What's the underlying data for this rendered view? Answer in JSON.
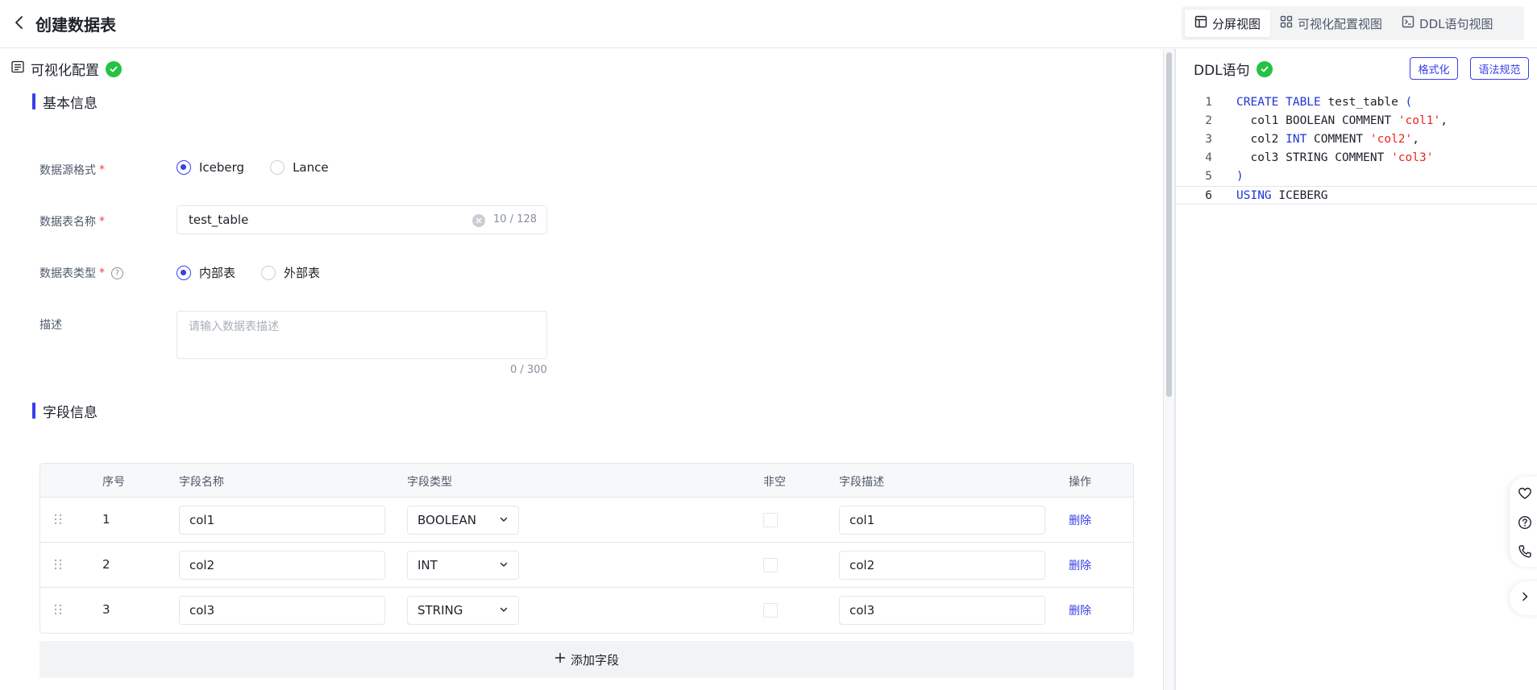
{
  "header": {
    "title": "创建数据表",
    "views": [
      {
        "label": "分屏视图",
        "icon": "split-view-icon",
        "active": true
      },
      {
        "label": "可视化配置视图",
        "icon": "grid-view-icon",
        "active": false
      },
      {
        "label": "DDL语句视图",
        "icon": "terminal-icon",
        "active": false
      }
    ]
  },
  "visual": {
    "title": "可视化配置",
    "basic_title": "基本信息",
    "format_label": "数据源格式",
    "format_options": [
      "Iceberg",
      "Lance"
    ],
    "format_selected": "Iceberg",
    "name_label": "数据表名称",
    "name_value": "test_table",
    "name_counter": "10 / 128",
    "type_label": "数据表类型",
    "type_options": [
      "内部表",
      "外部表"
    ],
    "type_selected": "内部表",
    "desc_label": "描述",
    "desc_placeholder": "请输入数据表描述",
    "desc_counter": "0 / 300",
    "required_mark": "*",
    "help_mark": "?"
  },
  "fields": {
    "title": "字段信息",
    "columns": [
      "序号",
      "字段名称",
      "字段类型",
      "非空",
      "字段描述",
      "操作"
    ],
    "rows": [
      {
        "no": "1",
        "name": "col1",
        "type": "BOOLEAN",
        "not_null": false,
        "desc": "col1",
        "action": "删除"
      },
      {
        "no": "2",
        "name": "col2",
        "type": "INT",
        "not_null": false,
        "desc": "col2",
        "action": "删除"
      },
      {
        "no": "3",
        "name": "col3",
        "type": "STRING",
        "not_null": false,
        "desc": "col3",
        "action": "删除"
      }
    ],
    "add_label": "添加字段"
  },
  "ddl": {
    "title": "DDL语句",
    "format_button": "格式化",
    "syntax_button": "语法规范",
    "lines": [
      "1",
      "2",
      "3",
      "4",
      "5",
      "6"
    ],
    "code": [
      "CREATE TABLE test_table (",
      "  col1 BOOLEAN COMMENT 'col1',",
      "  col2 INT COMMENT 'col2',",
      "  col3 STRING COMMENT 'col3'",
      ")",
      "USING ICEBERG"
    ]
  },
  "colors": {
    "accent": "#3640e6",
    "success": "#23c343",
    "required": "#f53f3f",
    "keyword": "#1f35d6",
    "string": "#e8261c"
  },
  "float_icons": [
    "favorite-icon",
    "help-icon",
    "phone-icon",
    "chevron-right-icon"
  ]
}
